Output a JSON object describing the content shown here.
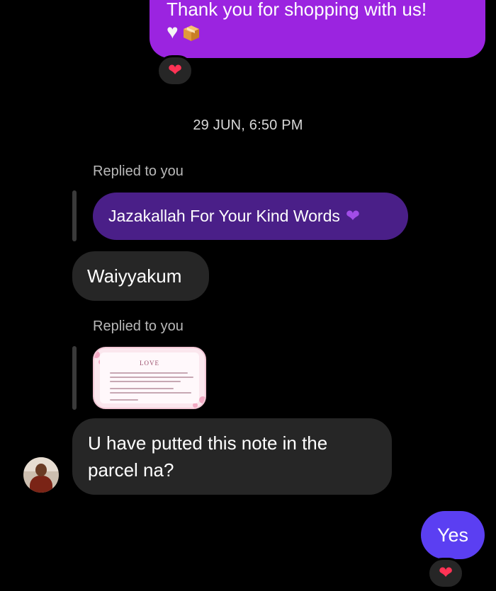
{
  "messages": {
    "outgoing_top": {
      "text": "Thank you for shopping with us!",
      "emoji_1": "white-heart",
      "emoji_2": "package-box",
      "reaction": "red-heart"
    },
    "timestamp": "29 JUN, 6:50 PM",
    "reply_1": {
      "label": "Replied to you",
      "quoted_text": "Jazakallah For Your Kind Words",
      "quoted_emoji": "purple-heart",
      "message": "Waiyyakum"
    },
    "reply_2": {
      "label": "Replied to you",
      "quoted_image": "love-note-image",
      "note_title": "LOVE",
      "message": "U have putted this note in the parcel na?"
    },
    "outgoing_yes": {
      "text": "Yes",
      "reaction": "red-heart"
    }
  },
  "colors": {
    "background": "#000000",
    "outgoing_bubble": "#9b24e0",
    "outgoing_yes_bubble": "#5b3ff2",
    "quoted_bubble": "#4a1f88",
    "incoming_bubble": "#262626",
    "reaction_heart": "#ff3355"
  }
}
